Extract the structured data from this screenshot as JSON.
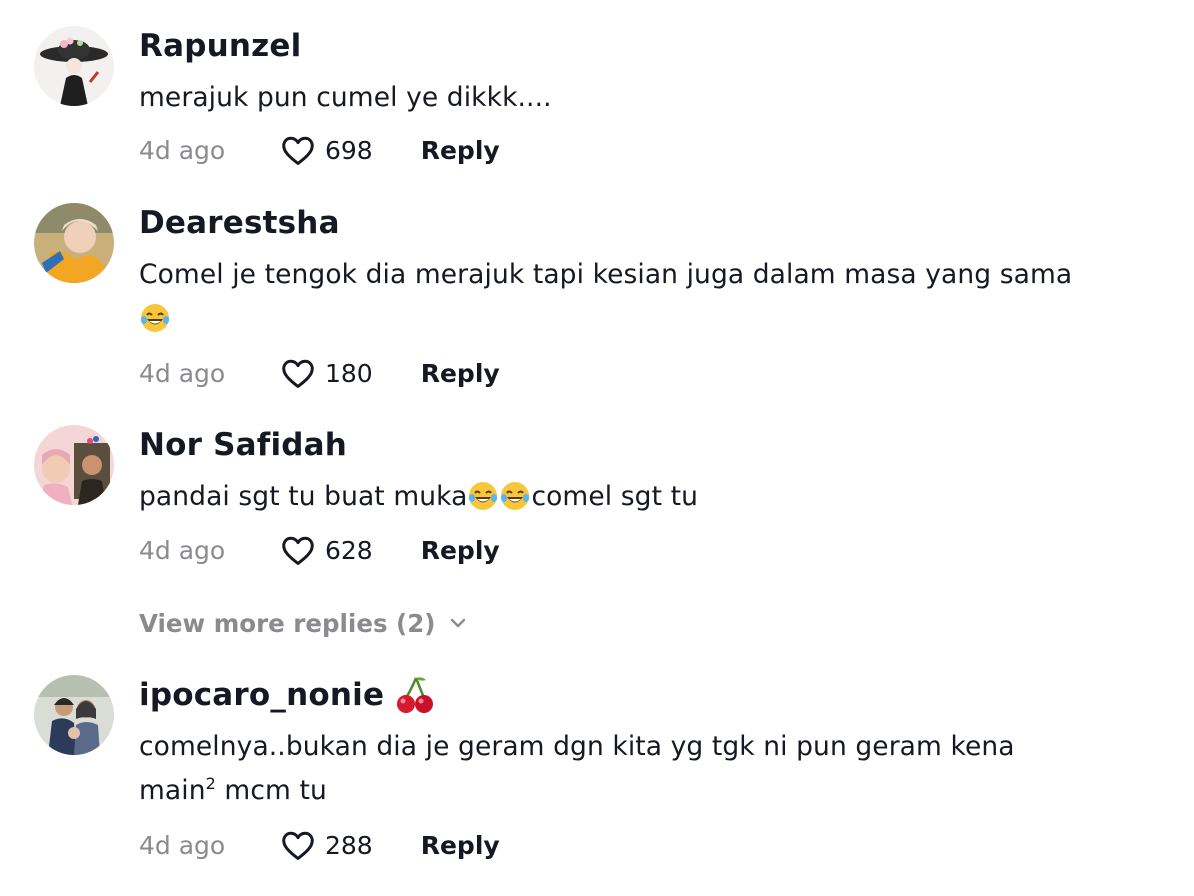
{
  "comments": [
    {
      "username": "Rapunzel",
      "text": "merajuk pun cumel ye dikkk....",
      "time": "4d ago",
      "likes": "698",
      "reply_label": "Reply"
    },
    {
      "username": "Dearestsha",
      "text": "Comel je tengok dia merajuk tapi kesian juga dalam masa yang sama",
      "emoji": "😂",
      "time": "4d ago",
      "likes": "180",
      "reply_label": "Reply"
    },
    {
      "username": "Nor Safidah",
      "text_before": "pandai sgt tu buat muka",
      "emoji": "😂😂",
      "text_after": "comel sgt tu",
      "time": "4d ago",
      "likes": "628",
      "reply_label": "Reply"
    },
    {
      "username": "ipocaro_nonie",
      "username_emoji": "🍒",
      "text_line1": "comelnya..bukan dia je geram dgn kita yg tgk ni pun geram kena",
      "text_line2_before": "main",
      "text_sup": "2",
      "text_line2_after": " mcm tu",
      "time": "4d ago",
      "likes": "288",
      "reply_label": "Reply"
    }
  ],
  "view_more_replies": "View more replies (2)",
  "icons": {
    "like": "heart-outline-icon",
    "expand": "chevron-down-icon"
  },
  "colors": {
    "text": "#161823",
    "muted": "#8a8b91"
  }
}
